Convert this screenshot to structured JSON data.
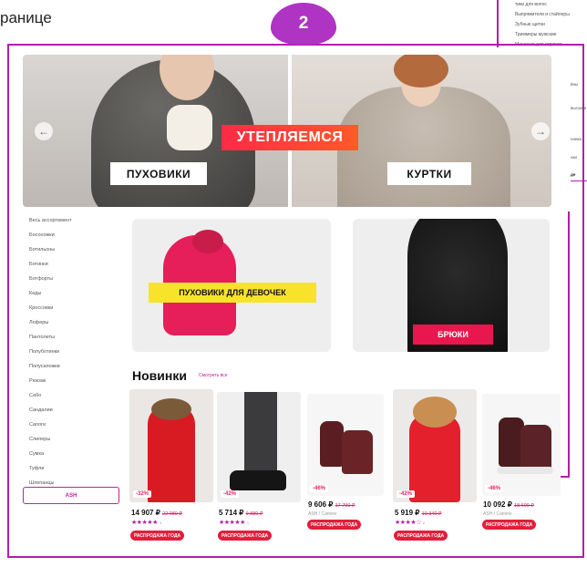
{
  "header": {
    "partial_text": "ранице",
    "step_badge": "2"
  },
  "right_pane": {
    "lines": [
      "тики для волос",
      "Выпрямители и стайлеры",
      "Зубные щетки",
      "Триммеры мужские",
      "Машинки для стрижки"
    ],
    "side_lines": [
      "йны",
      "высокие",
      "нника",
      "нки",
      "де"
    ]
  },
  "hero": {
    "left_label": "ПУХОВИКИ",
    "right_label": "КУРТКИ",
    "center_label": "УТЕПЛЯЕМСЯ",
    "prev_icon": "←",
    "next_icon": "→"
  },
  "sidebar": {
    "categories": [
      "Весь ассортимент",
      "Босоножки",
      "Ботильоны",
      "Ботинки",
      "Ботфорты",
      "Кеды",
      "Кроссовки",
      "Лоферы",
      "Пантолеты",
      "Полуботинки",
      "Полусапожки",
      "Рюкзак",
      "Сабо",
      "Сандалии",
      "Сапоги",
      "Слиперы",
      "Сумка",
      "Туфли",
      "Шлепанцы"
    ],
    "brand_button": "ASH"
  },
  "banners": {
    "girls_down": "ПУХОВИКИ ДЛЯ ДЕВОЧЕК",
    "trousers": "БРЮКИ"
  },
  "new_arrivals": {
    "title": "Новинки",
    "see_all": "Смотреть все",
    "products": [
      {
        "discount": "-32%",
        "price": "14 907 ₽",
        "old_price": "22 080 ₽",
        "brand": "",
        "stars": "★★★★★",
        "reviews": "3",
        "tag": "РАСПРОДАЖА ГОДА"
      },
      {
        "discount": "-42%",
        "price": "5 714 ₽",
        "old_price": "9 880 ₽",
        "brand": "",
        "stars": "★★★★★",
        "reviews": "1",
        "tag": "РАСПРОДАЖА ГОДА"
      },
      {
        "discount": "-46%",
        "price": "9 606 ₽",
        "old_price": "17 790 ₽",
        "brand": "ASH / Сапоги",
        "stars": "",
        "reviews": "",
        "tag": "РАСПРОДАЖА ГОДА"
      },
      {
        "discount": "-42%",
        "price": "5 919 ₽",
        "old_price": "10 340 ₽",
        "brand": "",
        "stars": "★★★★☆",
        "reviews": "2",
        "tag": "РАСПРОДАЖА ГОДА"
      },
      {
        "discount": "-46%",
        "price": "10 092 ₽",
        "old_price": "18 690 ₽",
        "brand": "ASH / Сапоги",
        "stars": "",
        "reviews": "",
        "tag": "РАСПРОДАЖА ГОДА"
      }
    ]
  },
  "colors": {
    "frame": "#b21fa8",
    "badge": "#b034c3",
    "sale": "#e31e3b",
    "accent_pink": "#e91e63"
  }
}
